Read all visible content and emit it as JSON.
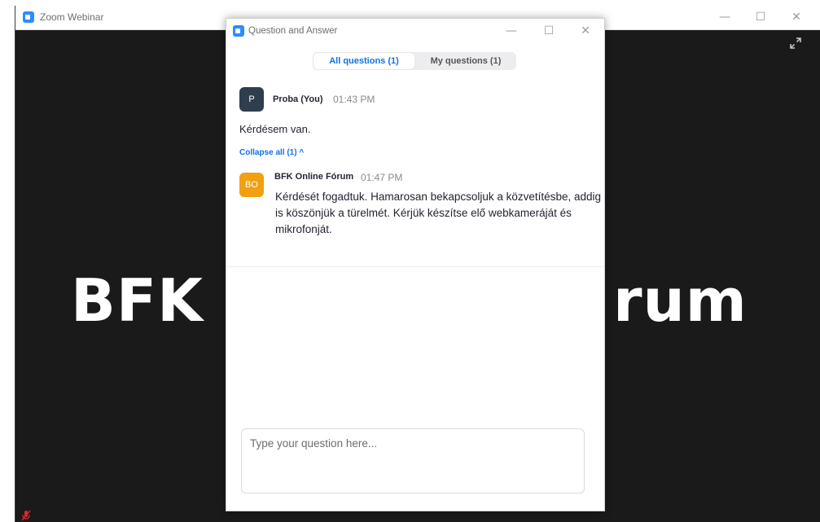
{
  "main_window": {
    "title": "Zoom Webinar",
    "controls": {
      "minimize": "—",
      "maximize": "☐",
      "close": "✕"
    },
    "background_text_left": "BFK",
    "background_text_right": "rum"
  },
  "qa_dialog": {
    "title": "Question and Answer",
    "controls": {
      "minimize": "—",
      "maximize": "☐",
      "close": "✕"
    },
    "tabs": [
      {
        "label": "All questions (1)",
        "active": true
      },
      {
        "label": "My questions (1)",
        "active": false
      }
    ],
    "question": {
      "avatar": "P",
      "author": "Proba (You)",
      "time": "01:43 PM",
      "text": "Kérdésem van."
    },
    "collapse_label": "Collapse all (1) ^",
    "answer": {
      "avatar": "BO",
      "author": "BFK Online Fórum",
      "time": "01:47 PM",
      "text": "Kérdését fogadtuk. Hamarosan bekapcsoljuk a közvetítésbe, addig is köszönjük a türelmét. Kérjük készítse elő webkameráját és mikrofonját."
    },
    "input": {
      "placeholder": "Type your question here...",
      "value": ""
    }
  },
  "colors": {
    "accent": "#0e71eb",
    "zoom_blue": "#2d8cff",
    "avatar_proba": "#2f3e4e",
    "avatar_bfk": "#f0a010",
    "video_background": "#1a1a1a"
  }
}
